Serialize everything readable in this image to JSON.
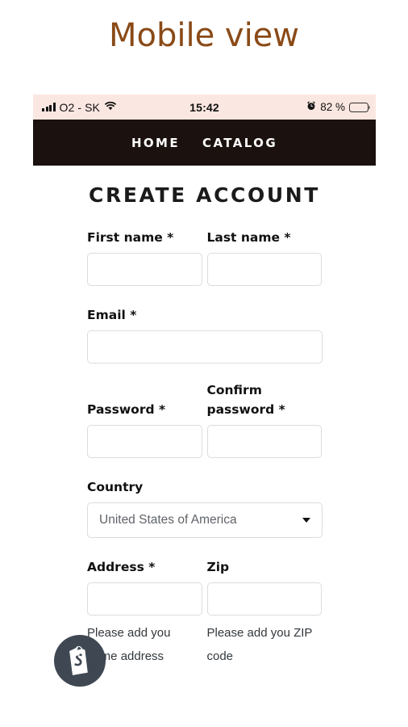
{
  "page": {
    "title": "Mobile view",
    "title_color": "#8a4a17",
    "background": "#ffffff"
  },
  "status_bar": {
    "background": "#fbe7e1",
    "carrier": "O2 - SK",
    "time": "15:42",
    "battery_percent": "82 %",
    "battery_level": 82,
    "icons": {
      "signal": "signal-bars-icon",
      "wifi": "wifi-icon",
      "alarm": "alarm-clock-icon",
      "battery": "battery-icon"
    }
  },
  "nav": {
    "background": "#1b110e",
    "text_color": "#ffffff",
    "items": [
      {
        "label": "HOME"
      },
      {
        "label": "CATALOG"
      }
    ]
  },
  "form": {
    "heading": "CREATE ACCOUNT",
    "fields": {
      "first_name": {
        "label": "First name *",
        "value": "",
        "placeholder": ""
      },
      "last_name": {
        "label": "Last name *",
        "value": "",
        "placeholder": ""
      },
      "email": {
        "label": "Email *",
        "value": "",
        "placeholder": ""
      },
      "password": {
        "label": "Password *",
        "value": "",
        "placeholder": ""
      },
      "confirm_password": {
        "label": "Confirm password *",
        "value": "",
        "placeholder": ""
      },
      "country": {
        "label": "Country",
        "selected": "United States of America",
        "caret": "chevron-down-icon"
      },
      "address": {
        "label": "Address *",
        "value": "",
        "placeholder": "",
        "help": "Please add you home address"
      },
      "zip": {
        "label": "Zip",
        "value": "",
        "placeholder": "",
        "help": "Please add you ZIP code"
      }
    }
  },
  "shopify_badge": {
    "name": "shopify-logo-icon",
    "background": "#3f4852",
    "mark_color": "#ffffff"
  }
}
